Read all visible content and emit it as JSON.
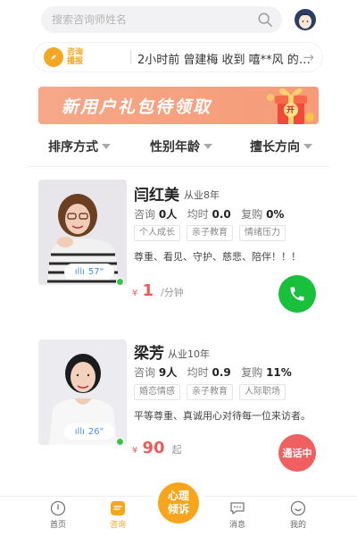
{
  "search": {
    "placeholder": "搜索咨询师姓名"
  },
  "notice": {
    "badge_line1": "咨询",
    "badge_line2": "播报",
    "text": "2小时前 曾建梅 收到 嘻**风 的一…"
  },
  "banner": {
    "text": "新用户礼包待领取",
    "gift_label": "开"
  },
  "filters": [
    {
      "label": "排序方式"
    },
    {
      "label": "性别年龄"
    },
    {
      "label": "擅长方向"
    }
  ],
  "counselors": [
    {
      "name": "闫红美",
      "years": "从业8年",
      "stats": {
        "consult_label": "咨询",
        "consult_value": "0人",
        "avg_label": "均时",
        "avg_value": "0.0",
        "repurchase_label": "复购",
        "repurchase_value": "0%"
      },
      "tags": [
        "个人成长",
        "亲子教育",
        "情绪压力"
      ],
      "intro": "尊重、看见、守护、慈悲、陪伴！！！",
      "voice": "57\"",
      "price": {
        "currency": "¥",
        "value": "1",
        "unit": "/分钟"
      },
      "call_state": "available",
      "call_color": "#19c03c"
    },
    {
      "name": "梁芳",
      "years": "从业10年",
      "stats": {
        "consult_label": "咨询",
        "consult_value": "9人",
        "avg_label": "均时",
        "avg_value": "0.9",
        "repurchase_label": "复购",
        "repurchase_value": "11%"
      },
      "tags": [
        "婚恋情感",
        "亲子教育",
        "人际职场"
      ],
      "intro": "平等尊重、真诚用心对待每一位来访者。",
      "voice": "26\"",
      "price": {
        "currency": "¥",
        "value": "90",
        "unit": "起"
      },
      "call_state": "busy",
      "call_label": "通话中",
      "call_color": "#f06060"
    }
  ],
  "tabbar": {
    "items": [
      {
        "label": "首页",
        "icon": "home-icon"
      },
      {
        "label": "咨询",
        "icon": "consult-icon",
        "active": true
      },
      {
        "label": "消息",
        "icon": "message-icon"
      },
      {
        "label": "我的",
        "icon": "profile-icon"
      }
    ],
    "center_line1": "心理",
    "center_line2": "倾诉"
  },
  "colors": {
    "accent": "#f7a51c",
    "price": "#f05a5a",
    "call_green": "#19c03c",
    "call_busy": "#f06060"
  }
}
